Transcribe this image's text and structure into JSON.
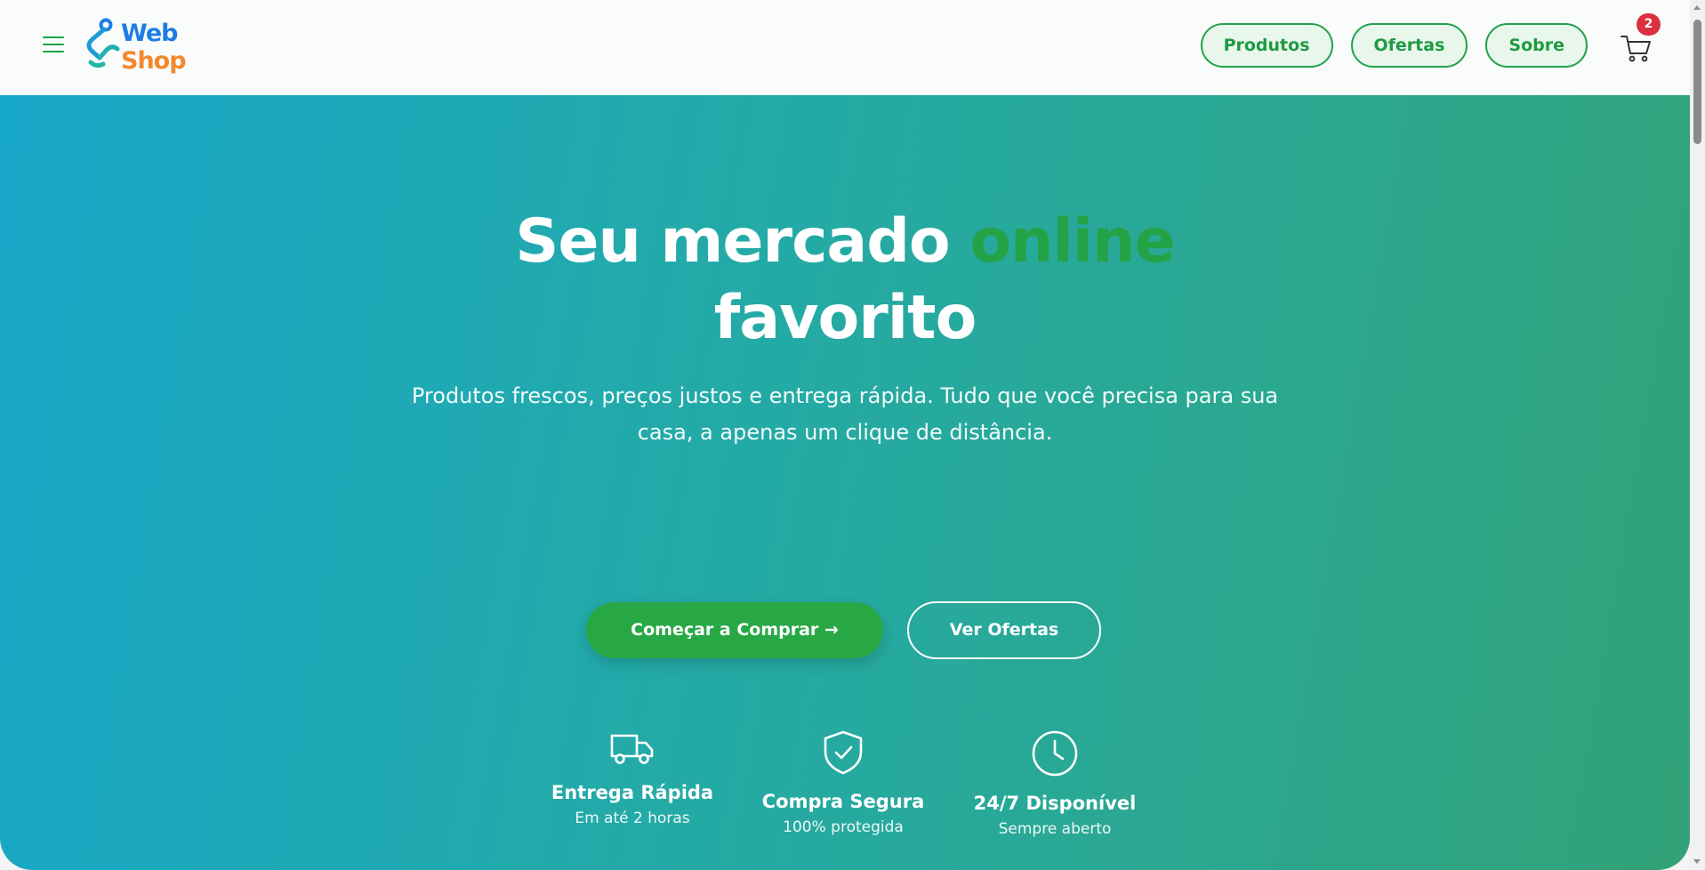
{
  "header": {
    "logo": {
      "line1": "Web",
      "line2": "Shop"
    },
    "nav": [
      {
        "label": "Produtos"
      },
      {
        "label": "Ofertas"
      },
      {
        "label": "Sobre"
      }
    ],
    "cart_count": "2"
  },
  "hero": {
    "title_part1": "Seu mercado ",
    "title_accent": "online",
    "title_part2": "favorito",
    "subtitle": "Produtos frescos, preços justos e entrega rápida. Tudo que você precisa para sua casa, a apenas um clique de distância.",
    "primary_cta": "Começar a Comprar →",
    "secondary_cta": "Ver Ofertas",
    "features": [
      {
        "icon": "truck-icon",
        "title": "Entrega Rápida",
        "subtitle": "Em até 2 horas"
      },
      {
        "icon": "shield-check-icon",
        "title": "Compra Segura",
        "subtitle": "100% protegida"
      },
      {
        "icon": "clock-icon",
        "title": "24/7 Disponível",
        "subtitle": "Sempre aberto"
      }
    ]
  },
  "colors": {
    "brand_green": "#28a845",
    "accent_green": "#24a246",
    "logo_blue": "#1d7de3",
    "logo_orange": "#f2892e",
    "badge_red": "#dc2f3f",
    "gradient_start": "#17a7c9",
    "gradient_end": "#31a277"
  }
}
